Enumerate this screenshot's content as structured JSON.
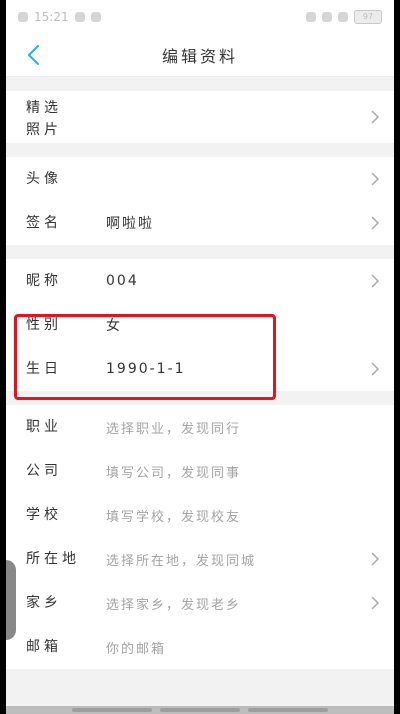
{
  "status_bar": {
    "time": "15:21",
    "battery": "97"
  },
  "header": {
    "title": "编辑资料"
  },
  "sections": {
    "photos": {
      "label": "精选照片"
    },
    "profile": {
      "avatar_label": "头像",
      "signature_label": "签名",
      "signature_value": "啊啦啦"
    },
    "basic": {
      "nickname_label": "昵称",
      "nickname_value": "004",
      "gender_label": "性别",
      "gender_value": "女",
      "birthday_label": "生日",
      "birthday_value": "1990-1-1"
    },
    "more": {
      "job_label": "职业",
      "job_placeholder": "选择职业，发现同行",
      "company_label": "公司",
      "company_placeholder": "填写公司，发现同事",
      "school_label": "学校",
      "school_placeholder": "填写学校，发现校友",
      "location_label": "所在地",
      "location_placeholder": "选择所在地，发现同城",
      "hometown_label": "家乡",
      "hometown_placeholder": "选择家乡，发现老乡",
      "email_label": "邮箱",
      "email_placeholder": "你的邮箱"
    }
  },
  "colors": {
    "accent": "#2fb3e6",
    "highlight": "#e5131d"
  }
}
